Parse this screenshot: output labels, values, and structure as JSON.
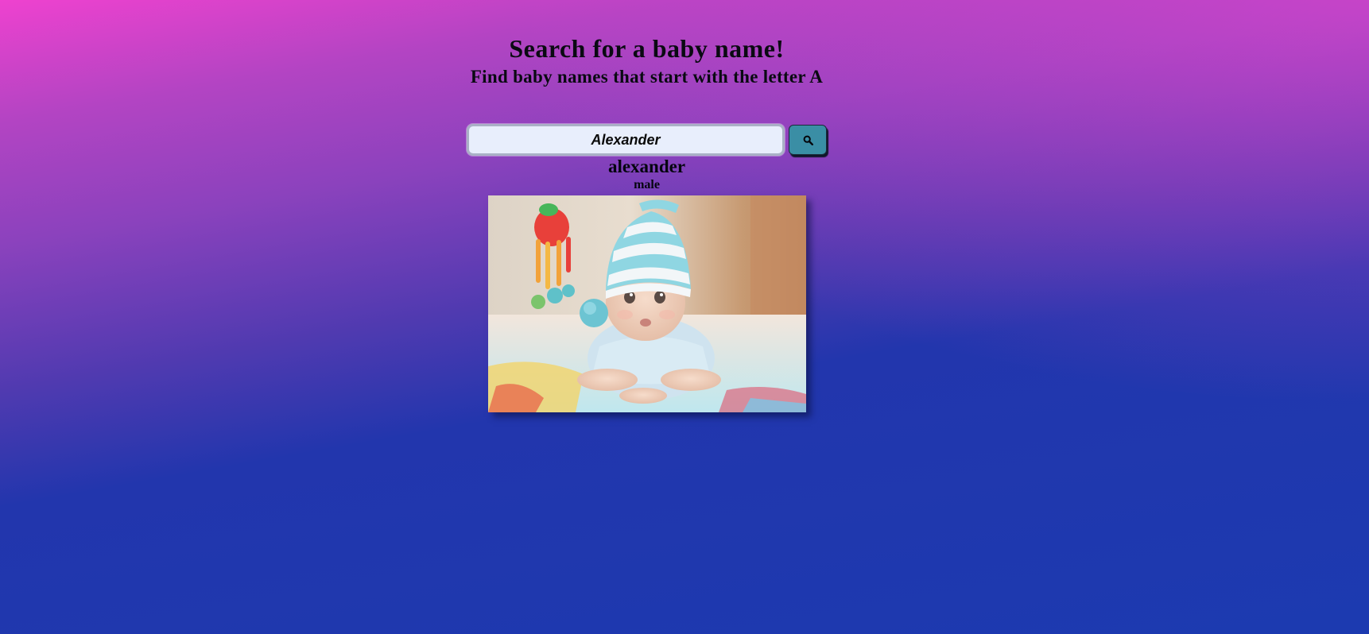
{
  "header": {
    "title": "Search for a baby name!",
    "subtitle": "Find baby names that start with the letter A"
  },
  "search": {
    "value": "Alexander",
    "button_icon": "search-icon"
  },
  "result": {
    "name": "alexander",
    "gender": "male",
    "photo_icon": "baby-photo"
  },
  "colors": {
    "background_top": "#ee42cf",
    "background_bottom": "#1c3ab0",
    "search_button": "#3a8ea5",
    "input_background": "#e8eefc"
  }
}
